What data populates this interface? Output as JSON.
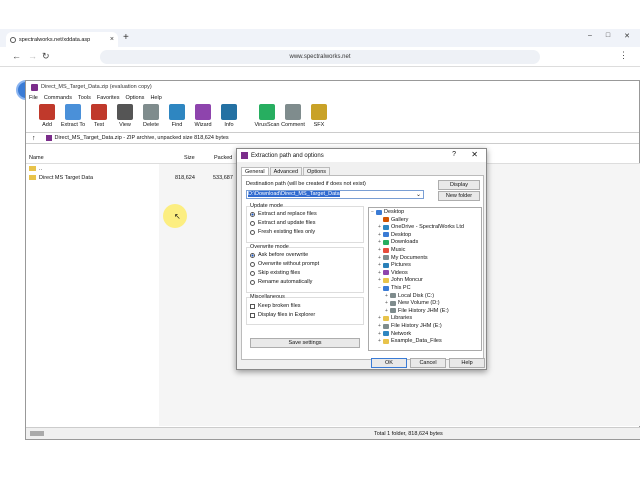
{
  "browser": {
    "tab_title": "spectralworks.net/xddata.asp",
    "url": "www.spectralworks.net",
    "window_buttons": [
      "–",
      "□",
      "✕"
    ]
  },
  "app": {
    "title": "Direct_MS_Target_Data.zip (evaluation copy)",
    "menu": [
      "File",
      "Commands",
      "Tools",
      "Favorites",
      "Options",
      "Help"
    ],
    "toolbar": [
      {
        "label": "Add",
        "icon": "add-archive-icon",
        "color": "#c0392b"
      },
      {
        "label": "Extract To",
        "icon": "extract-folder-icon",
        "color": "#4a90d9"
      },
      {
        "label": "Test",
        "icon": "test-icon",
        "color": "#c0392b"
      },
      {
        "label": "View",
        "icon": "view-book-icon",
        "color": "#555555"
      },
      {
        "label": "Delete",
        "icon": "delete-icon",
        "color": "#7f8c8d"
      },
      {
        "label": "Find",
        "icon": "find-magnifier-icon",
        "color": "#2e86c1"
      },
      {
        "label": "Wizard",
        "icon": "wizard-wand-icon",
        "color": "#8e44ad"
      },
      {
        "label": "Info",
        "icon": "info-icon",
        "color": "#2471a3"
      },
      {
        "label": "VirusScan",
        "icon": "virusscan-icon",
        "color": "#27ae60"
      },
      {
        "label": "Comment",
        "icon": "comment-icon",
        "color": "#7f8c8d"
      },
      {
        "label": "SFX",
        "icon": "sfx-icon",
        "color": "#c9a227"
      }
    ],
    "path": "Direct_MS_Target_Data.zip - ZIP archive, unpacked size 818,624 bytes",
    "columns": {
      "name": "Name",
      "size": "Size",
      "packed": "Packed"
    },
    "rows": [
      {
        "name": "..",
        "size": "",
        "packed": ""
      },
      {
        "name": "Direct MS Target Data",
        "size": "818,624",
        "packed": "533,687"
      }
    ],
    "status": "Total 1 folder, 818,624 bytes"
  },
  "dialog": {
    "title": "Extraction path and options",
    "help_glyph": "?",
    "close_glyph": "✕",
    "tabs": [
      "General",
      "Advanced",
      "Options"
    ],
    "dest_label": "Destination path (will be created if does not exist)",
    "dest_value": "D:\\Download\\Direct_MS_Target_Data",
    "display_button": "Display",
    "new_folder_button": "New folder",
    "update_mode": {
      "label": "Update mode",
      "options": [
        "Extract and replace files",
        "Extract and update files",
        "Fresh existing files only"
      ],
      "selected": 0
    },
    "overwrite_mode": {
      "label": "Overwrite mode",
      "options": [
        "Ask before overwrite",
        "Overwrite without prompt",
        "Skip existing files",
        "Rename automatically"
      ],
      "selected": 0
    },
    "misc": {
      "label": "Miscellaneous",
      "options": [
        "Keep broken files",
        "Display files in Explorer"
      ]
    },
    "save_settings": "Save settings",
    "tree": [
      {
        "label": "Desktop",
        "level": 0,
        "exp": "−",
        "color": "#3a7bd5"
      },
      {
        "label": "Gallery",
        "level": 1,
        "exp": "",
        "color": "#d35400"
      },
      {
        "label": "OneDrive - SpectralWorks Ltd",
        "level": 1,
        "exp": "+",
        "color": "#2e86c1"
      },
      {
        "label": "Desktop",
        "level": 1,
        "exp": "+",
        "color": "#3a7bd5"
      },
      {
        "label": "Downloads",
        "level": 1,
        "exp": "+",
        "color": "#27ae60"
      },
      {
        "label": "Music",
        "level": 1,
        "exp": "+",
        "color": "#e74c3c"
      },
      {
        "label": "My Documents",
        "level": 1,
        "exp": "+",
        "color": "#7f8c8d"
      },
      {
        "label": "Pictures",
        "level": 1,
        "exp": "+",
        "color": "#2980b9"
      },
      {
        "label": "Videos",
        "level": 1,
        "exp": "+",
        "color": "#8e44ad"
      },
      {
        "label": "John Moncur",
        "level": 1,
        "exp": "+",
        "color": "#e8c34a"
      },
      {
        "label": "This PC",
        "level": 1,
        "exp": "−",
        "color": "#3a7bd5"
      },
      {
        "label": "Local Disk (C:)",
        "level": 2,
        "exp": "+",
        "color": "#7f8c8d"
      },
      {
        "label": "New Volume (D:)",
        "level": 2,
        "exp": "+",
        "color": "#7f8c8d"
      },
      {
        "label": "File History JHM (E:)",
        "level": 2,
        "exp": "+",
        "color": "#7f8c8d"
      },
      {
        "label": "Libraries",
        "level": 1,
        "exp": "+",
        "color": "#e8c34a"
      },
      {
        "label": "File History JHM (E:)",
        "level": 1,
        "exp": "+",
        "color": "#7f8c8d"
      },
      {
        "label": "Network",
        "level": 1,
        "exp": "+",
        "color": "#2e86c1"
      },
      {
        "label": "Example_Data_Files",
        "level": 1,
        "exp": "+",
        "color": "#e8c34a"
      }
    ],
    "ok": "OK",
    "cancel": "Cancel",
    "help": "Help"
  }
}
